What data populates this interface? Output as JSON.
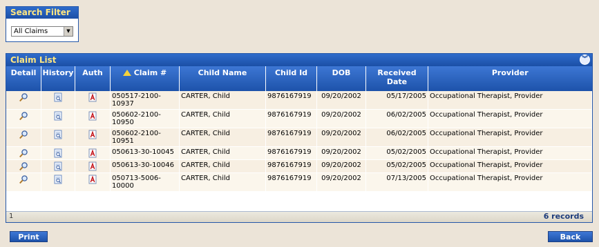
{
  "search_filter": {
    "title": "Search Filter",
    "selected": "All Claims"
  },
  "claim_list": {
    "title": "Claim List",
    "columns": [
      "Detail",
      "History",
      "Auth",
      "Claim #",
      "Child Name",
      "Child Id",
      "DOB",
      "Received Date",
      "Provider"
    ],
    "sorted_column": "Claim #",
    "rows": [
      {
        "claim": "050517-2100-10937",
        "child": "CARTER, Child",
        "child_id": "9876167919",
        "dob": "09/20/2002",
        "received": "05/17/2005",
        "provider": "Occupational Therapist, Provider"
      },
      {
        "claim": "050602-2100-10950",
        "child": "CARTER, Child",
        "child_id": "9876167919",
        "dob": "09/20/2002",
        "received": "06/02/2005",
        "provider": "Occupational Therapist, Provider"
      },
      {
        "claim": "050602-2100-10951",
        "child": "CARTER, Child",
        "child_id": "9876167919",
        "dob": "09/20/2002",
        "received": "06/02/2005",
        "provider": "Occupational Therapist, Provider"
      },
      {
        "claim": "050613-30-10045",
        "child": "CARTER, Child",
        "child_id": "9876167919",
        "dob": "09/20/2002",
        "received": "05/02/2005",
        "provider": "Occupational Therapist, Provider"
      },
      {
        "claim": "050613-30-10046",
        "child": "CARTER, Child",
        "child_id": "9876167919",
        "dob": "09/20/2002",
        "received": "05/02/2005",
        "provider": "Occupational Therapist, Provider"
      },
      {
        "claim": "050713-5006-10000",
        "child": "CARTER, Child",
        "child_id": "9876167919",
        "dob": "09/20/2002",
        "received": "07/13/2005",
        "provider": "Occupational Therapist, Provider"
      }
    ],
    "page": "1",
    "record_count": "6 records"
  },
  "buttons": {
    "print": "Print",
    "back": "Back"
  },
  "icons": {
    "detail": "magnifier-icon",
    "history": "document-search-icon",
    "auth": "pdf-document-icon",
    "collapse": "double-chevron-down-icon"
  },
  "colors": {
    "panel_header": "#1b4fa6",
    "panel_title_text": "#ffe680",
    "row_odd": "#f7efe2",
    "row_even": "#fbf6ec",
    "page_bg": "#ece4d8"
  }
}
